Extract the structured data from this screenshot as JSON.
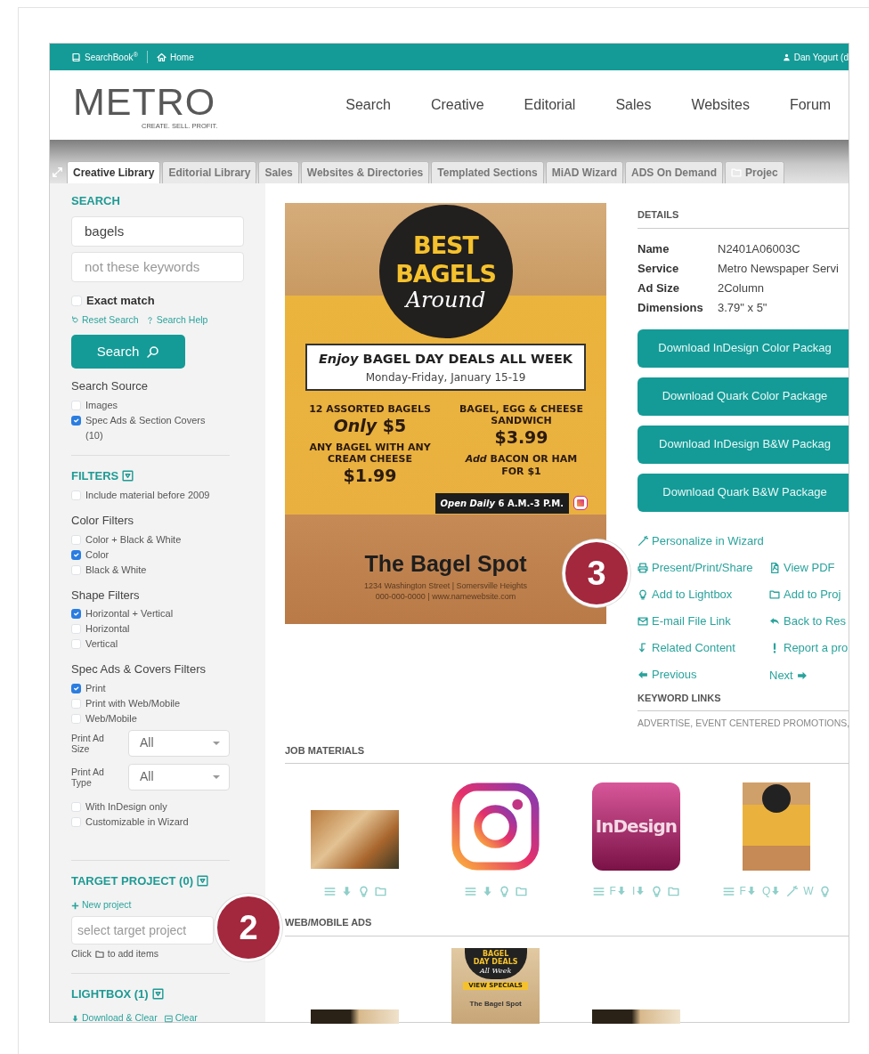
{
  "top_bar": {
    "links": [
      {
        "kind": "book",
        "label": "SearchBook$^{®}$"
      },
      {
        "kind": "home",
        "label": "Home"
      }
    ],
    "user": "Dan Yogurt (d"
  },
  "header": {
    "logo": "METRO",
    "tagline": "CREATE. SELL. PROFIT.",
    "nav": [
      "Search",
      "Creative",
      "Editorial",
      "Sales",
      "Websites",
      "Forum"
    ]
  },
  "tabs": [
    {
      "label": "Creative Library",
      "selected": true,
      "kind": "plain"
    },
    {
      "label": "Editorial Library",
      "selected": false,
      "kind": "plain"
    },
    {
      "label": "Sales",
      "selected": false,
      "kind": "plain"
    },
    {
      "label": "Websites & Directories",
      "selected": false,
      "kind": "plain"
    },
    {
      "label": "Templated Sections",
      "selected": false,
      "kind": "plain"
    },
    {
      "label": "MiAD Wizard",
      "selected": false,
      "kind": "plain"
    },
    {
      "label": "ADS On Demand",
      "selected": false,
      "kind": "plain"
    },
    {
      "label": "Projec",
      "selected": false,
      "kind": "folder"
    }
  ],
  "sidebar": {
    "search": {
      "heading": "SEARCH",
      "query": "bagels",
      "exclude_placeholder": "not these keywords",
      "exact_match": {
        "label": "Exact match",
        "checked": false
      },
      "links": [
        {
          "kind": "reset",
          "label": "Reset Search"
        },
        {
          "kind": "help",
          "label": "Search Help"
        }
      ],
      "button": "Search"
    },
    "search_source": {
      "title": "Search Source",
      "items": [
        {
          "label": "Images",
          "checked": false
        },
        {
          "label": "Spec Ads & Section Covers (10)",
          "checked": true
        }
      ]
    },
    "filters": {
      "heading": "FILTERS",
      "items": [
        {
          "label": "Include material before 2009",
          "checked": false
        }
      ],
      "groups": [
        {
          "title": "Color Filters",
          "items": [
            {
              "label": "Color + Black & White",
              "checked": false
            },
            {
              "label": "Color",
              "checked": true
            },
            {
              "label": "Black & White",
              "checked": false
            }
          ]
        },
        {
          "title": "Shape Filters",
          "items": [
            {
              "label": "Horizontal + Vertical",
              "checked": true
            },
            {
              "label": "Horizontal",
              "checked": false
            },
            {
              "label": "Vertical",
              "checked": false
            }
          ]
        },
        {
          "title": "Spec Ads & Covers Filters",
          "items": [
            {
              "label": "Print",
              "checked": true
            },
            {
              "label": "Print with Web/Mobile",
              "checked": false
            },
            {
              "label": "Web/Mobile",
              "checked": false
            }
          ],
          "selects": [
            {
              "label": "Print Ad Size",
              "value": "All"
            },
            {
              "label": "Print Ad Type",
              "value": "All"
            }
          ],
          "after_items": [
            {
              "label": "With InDesign only",
              "checked": false
            },
            {
              "label": "Customizable in Wizard",
              "checked": false
            }
          ]
        }
      ]
    },
    "target_project": {
      "heading": "TARGET PROJECT (0)",
      "new_link": "New project",
      "placeholder": "select target project",
      "hint_before": "Click",
      "hint_after": "to add items"
    },
    "lightbox": {
      "heading": "LIGHTBOX (1)",
      "links": [
        {
          "kind": "download",
          "label": "Download & Clear"
        },
        {
          "kind": "minus",
          "label": "Clear"
        }
      ]
    }
  },
  "flyer": {
    "title": "BEST BAGELS",
    "title_script": "Around",
    "banner": "*Enjoy* **BAGEL DAY DEALS ALL WEEK**",
    "dates": "Monday-Friday, January 15-19",
    "columns": [
      {
        "deals": [
          {
            "title": "12 ASSORTED BAGELS",
            "price": "*Only* $5"
          },
          {
            "title": "ANY BAGEL WITH ANY CREAM CHEESE",
            "price": "$1.99"
          }
        ]
      },
      {
        "deals": [
          {
            "title": "BAGEL, EGG & CHEESE SANDWICH",
            "price": "$3.99",
            "note": "*Add* BACON OR HAM FOR $1"
          }
        ]
      }
    ],
    "hours": "*Open Daily* 6 A.M.-3 P.M.",
    "business": "The Bagel Spot",
    "address": "1234 Washington Street | Somersville Heights",
    "contact": "000-000-0000 | www.namewebsite.com"
  },
  "details": {
    "heading": "DETAILS",
    "fields": [
      {
        "label": "Name",
        "value": "N2401A06003C"
      },
      {
        "label": "Service",
        "value": "Metro Newspaper Servi"
      },
      {
        "label": "Ad Size",
        "value": "2Column"
      },
      {
        "label": "Dimensions",
        "value": "3.79\" x 5\""
      }
    ],
    "buttons": [
      "Download InDesign Color Packag",
      "Download Quark Color Package",
      "Download InDesign B&W Packag",
      "Download Quark B&W Package"
    ],
    "action_rows": [
      {
        "items": [
          {
            "kind": "wand",
            "label": "Personalize in Wizard"
          }
        ]
      },
      {
        "items": [
          {
            "kind": "print",
            "label": "Present/Print/Share"
          },
          {
            "kind": "pdf",
            "label": "View PDF"
          }
        ]
      },
      {
        "items": [
          {
            "kind": "bulb",
            "label": "Add to Lightbox"
          },
          {
            "kind": "folder",
            "label": "Add to Proj"
          }
        ]
      },
      {
        "items": [
          {
            "kind": "mail",
            "label": "E-mail File Link"
          },
          {
            "kind": "back",
            "label": "Back to Res"
          }
        ]
      },
      {
        "items": [
          {
            "kind": "related",
            "label": "Related Content"
          },
          {
            "kind": "exclam",
            "label": "Report a pro"
          }
        ]
      },
      {
        "items": [
          {
            "kind": "prev",
            "label": "Previous"
          },
          {
            "kind": "next",
            "label": "Next"
          }
        ]
      }
    ],
    "keyword_heading": "KEYWORD LINKS",
    "keywords": "ADVERTISE, EVENT CENTERED PROMOTIONS,"
  },
  "job_materials": {
    "heading": "JOB MATERIALS",
    "items": [
      {
        "kind": "photo",
        "actions": [
          {
            "kind": "list"
          },
          {
            "kind": "download"
          },
          {
            "kind": "bulb"
          },
          {
            "kind": "folder"
          }
        ]
      },
      {
        "kind": "instagram",
        "actions": [
          {
            "kind": "list"
          },
          {
            "kind": "download"
          },
          {
            "kind": "bulb"
          },
          {
            "kind": "folder"
          }
        ]
      },
      {
        "kind": "indesign",
        "label": "InDesign",
        "actions": [
          {
            "kind": "list"
          },
          {
            "kind": "download",
            "letter": "F"
          },
          {
            "kind": "download",
            "letter": "I"
          },
          {
            "kind": "bulb"
          },
          {
            "kind": "folder"
          }
        ]
      },
      {
        "kind": "flyer",
        "actions": [
          {
            "kind": "list"
          },
          {
            "kind": "download",
            "letter": "F"
          },
          {
            "kind": "download",
            "letter": "Q"
          },
          {
            "kind": "wand"
          },
          {
            "kind": "letter",
            "letter": "W"
          },
          {
            "kind": "bulb"
          }
        ]
      }
    ]
  },
  "web_ads": {
    "heading": "WEB/MOBILE ADS",
    "items": [
      {
        "kind": "banner"
      },
      {
        "kind": "square",
        "texts": [
          "BAGEL DAY DEALS",
          "All Week",
          "VIEW SPECIALS",
          "The Bagel Spot"
        ]
      },
      {
        "kind": "banner"
      }
    ]
  },
  "callouts": [
    {
      "label": "2"
    },
    {
      "label": "3"
    }
  ]
}
